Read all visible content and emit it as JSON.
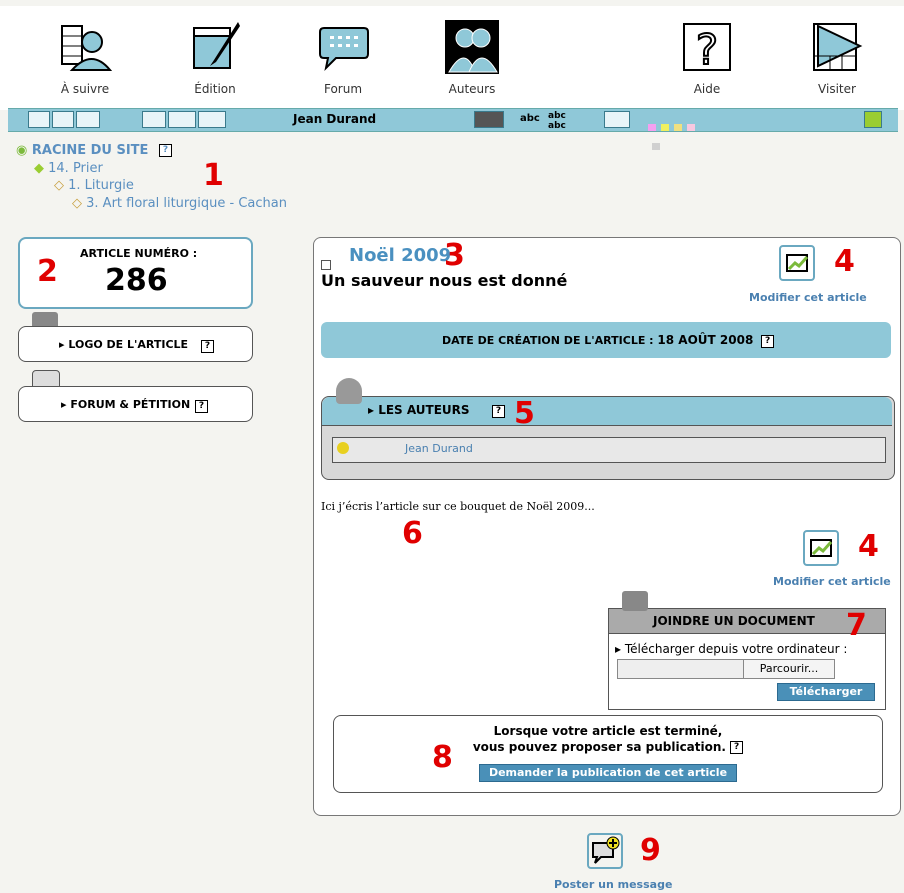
{
  "nav": {
    "items": [
      {
        "label": "À suivre"
      },
      {
        "label": "Édition"
      },
      {
        "label": "Forum"
      },
      {
        "label": "Auteurs"
      },
      {
        "label": "Aide"
      },
      {
        "label": "Visiter"
      }
    ]
  },
  "toolbar": {
    "user": "Jean Durand",
    "spell_label": "abc"
  },
  "breadcrumb": {
    "root": "RACINE DU SITE",
    "level1": "14. Prier",
    "level2": "1. Liturgie",
    "level3": "3. Art floral liturgique - Cachan"
  },
  "article_box": {
    "heading": "ARTICLE NUMÉRO :",
    "number": "286"
  },
  "left_panels": {
    "logo": "LOGO DE L'ARTICLE",
    "forum": "FORUM & PÉTITION"
  },
  "article": {
    "surtitle": "Noël 2009",
    "title": "Un sauveur nous est donné",
    "modify_label": "Modifier cet article",
    "date_label": "DATE DE CRÉATION DE L'ARTICLE :",
    "date_value": "18 AOÛT 2008",
    "authors_heading": "LES AUTEURS",
    "author_name": "Jean Durand",
    "body_text": "Ici j’écris l’article sur ce bouquet de Noël 2009..."
  },
  "attach": {
    "heading": "JOINDRE UN DOCUMENT",
    "from_computer": "Télécharger depuis votre ordinateur :",
    "browse": "Parcourir...",
    "upload": "Télécharger"
  },
  "publish": {
    "line1": "Lorsque votre article est terminé,",
    "line2": "vous pouvez proposer sa publication.",
    "button": "Demander la publication de cet article"
  },
  "forum_post": {
    "label": "Poster un message"
  },
  "annotations": [
    "1",
    "2",
    "3",
    "4",
    "4",
    "5",
    "6",
    "7",
    "8",
    "9"
  ],
  "colors": {
    "accent_blue": "#8fc8d8",
    "link_blue": "#5a8fc0",
    "annotation_red": "#e00000"
  }
}
